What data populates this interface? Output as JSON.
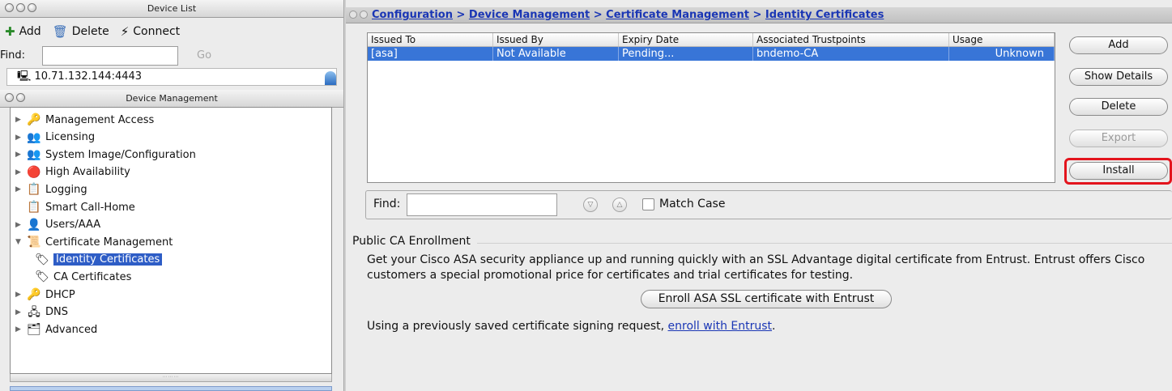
{
  "device_list": {
    "window_title": "Device List",
    "toolbar": {
      "add_label": "Add",
      "delete_label": "Delete",
      "connect_label": "Connect"
    },
    "find_label": "Find:",
    "find_value": "",
    "go_label": "Go",
    "device": "10.71.132.144:4443"
  },
  "device_management": {
    "window_title": "Device Management",
    "items": [
      {
        "label": "Management Access",
        "icon": "management-access-icon",
        "expanded": false,
        "has_children": true
      },
      {
        "label": "Licensing",
        "icon": "licensing-icon",
        "expanded": false,
        "has_children": true
      },
      {
        "label": "System Image/Configuration",
        "icon": "system-image-icon",
        "expanded": false,
        "has_children": true
      },
      {
        "label": "High Availability",
        "icon": "high-availability-icon",
        "expanded": false,
        "has_children": true
      },
      {
        "label": "Logging",
        "icon": "logging-icon",
        "expanded": false,
        "has_children": true
      },
      {
        "label": "Smart Call-Home",
        "icon": "smart-call-home-icon",
        "expanded": false,
        "has_children": false
      },
      {
        "label": "Users/AAA",
        "icon": "users-aaa-icon",
        "expanded": false,
        "has_children": true
      },
      {
        "label": "Certificate Management",
        "icon": "certificate-management-icon",
        "expanded": true,
        "has_children": true
      },
      {
        "label": "Identity Certificates",
        "icon": "identity-certificates-icon",
        "child": true,
        "selected": true
      },
      {
        "label": "CA Certificates",
        "icon": "ca-certificates-icon",
        "child": true
      },
      {
        "label": "DHCP",
        "icon": "dhcp-icon",
        "expanded": false,
        "has_children": true
      },
      {
        "label": "DNS",
        "icon": "dns-icon",
        "expanded": false,
        "has_children": true
      },
      {
        "label": "Advanced",
        "icon": "advanced-icon",
        "expanded": false,
        "has_children": true
      }
    ]
  },
  "breadcrumb": {
    "parts": [
      "Configuration",
      "Device Management",
      "Certificate Management",
      "Identity Certificates"
    ],
    "separator": ">"
  },
  "cert_table": {
    "columns": [
      "Issued To",
      "Issued By",
      "Expiry Date",
      "Associated Trustpoints",
      "Usage"
    ],
    "rows": [
      [
        "[asa]",
        "Not Available",
        "Pending...",
        "bndemo-CA",
        "Unknown"
      ]
    ]
  },
  "side_buttons": {
    "add": "Add",
    "show_details": "Show Details",
    "delete": "Delete",
    "export": "Export",
    "install": "Install"
  },
  "find_bar": {
    "label": "Find:",
    "value": "",
    "match_case_label": "Match Case",
    "match_case_checked": false
  },
  "enrollment": {
    "title": "Public CA Enrollment",
    "description": "Get your Cisco ASA security appliance up and running quickly with an SSL Advantage digital certificate from Entrust. Entrust offers Cisco customers a special promotional price for certificates and trial certificates for testing.",
    "button_label": "Enroll ASA SSL certificate with Entrust",
    "previous_text": "Using a previously saved certificate signing request,",
    "previous_link": "enroll with Entrust",
    "previous_suffix": "."
  },
  "colors": {
    "selection": "#3875d7",
    "link": "#1a36b5",
    "highlight_border": "#e3141d"
  }
}
